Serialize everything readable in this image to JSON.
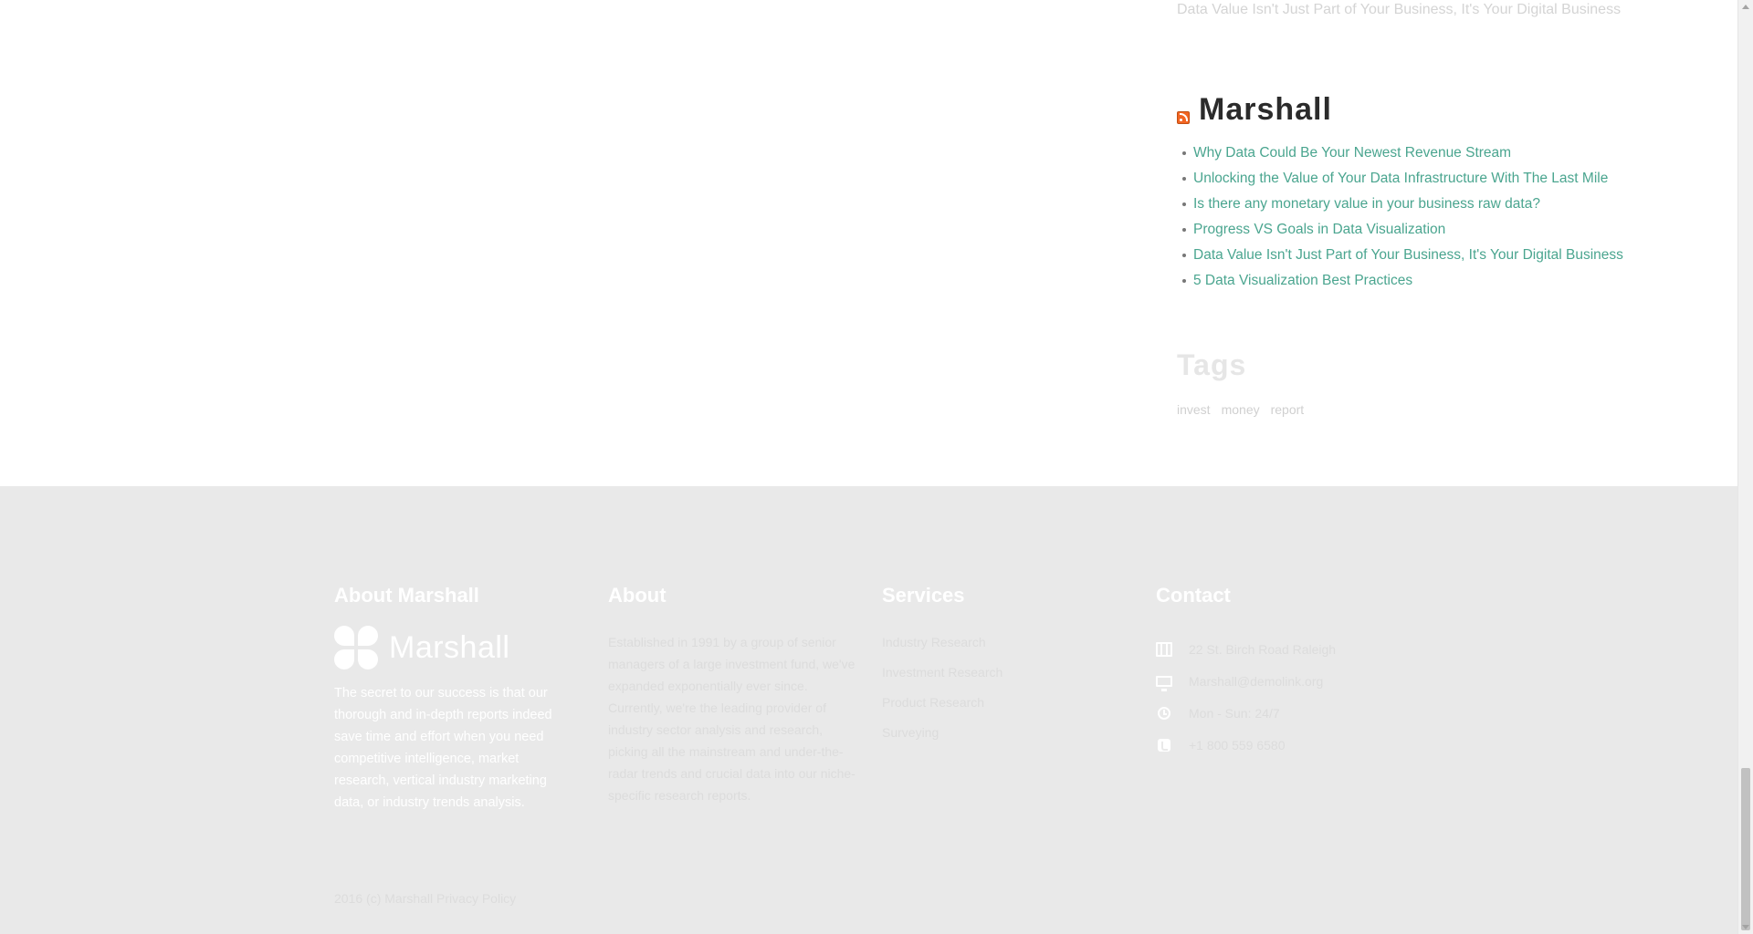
{
  "sidebar": {
    "top_link": "Data Value Isn't Just Part of Your Business, It's Your Digital Business",
    "rss": {
      "icon": "rss-icon",
      "title": "Marshall",
      "items": [
        "Why Data Could Be Your Newest Revenue Stream",
        "Unlocking the Value of Your Data Infrastructure With The Last Mile",
        "Is there any monetary value in your business raw data?",
        "Progress VS Goals in Data Visualization",
        "Data Value Isn't Just Part of Your Business, It's Your Digital Business",
        "5 Data Visualization Best Practices"
      ]
    },
    "tags": {
      "title": "Tags",
      "items": [
        "invest",
        "money",
        "report"
      ]
    }
  },
  "footer": {
    "about_marshall": {
      "title": "About Marshall",
      "logo_text": "Marshall",
      "text": "The secret to our success is that our thorough and in-depth reports indeed save time and effort when you need competitive intelligence, market research, vertical industry marketing data, or industry trends analysis."
    },
    "about": {
      "title": "About",
      "text": "Established in 1991 by a group of senior managers of a large investment fund, we've expanded exponentially ever since.   Currently, we're the leading provider of industry sector analysis and research, picking all the mainstream and under-the-radar trends and crucial data into our niche-specific research reports."
    },
    "services": {
      "title": "Services",
      "items": [
        "Industry Research",
        "Investment Research",
        "Product Research",
        "Surveying"
      ]
    },
    "contact": {
      "title": "Contact",
      "items": [
        {
          "icon": "map-icon",
          "text": "22 St. Birch Road Raleigh"
        },
        {
          "icon": "monitor-icon",
          "text": "Marshall@demolink.org"
        },
        {
          "icon": "clock-icon",
          "text": "Mon - Sun: 24/7"
        },
        {
          "icon": "phone-icon",
          "text": "+1 800 559 6580"
        }
      ]
    },
    "copyright": {
      "text": "2016 (c) Marshall",
      "privacy": "Privacy Policy"
    }
  },
  "colors": {
    "link": "#4aa58f",
    "footer_bg": "#e9e9e9",
    "rss_orange": "#f26522"
  }
}
